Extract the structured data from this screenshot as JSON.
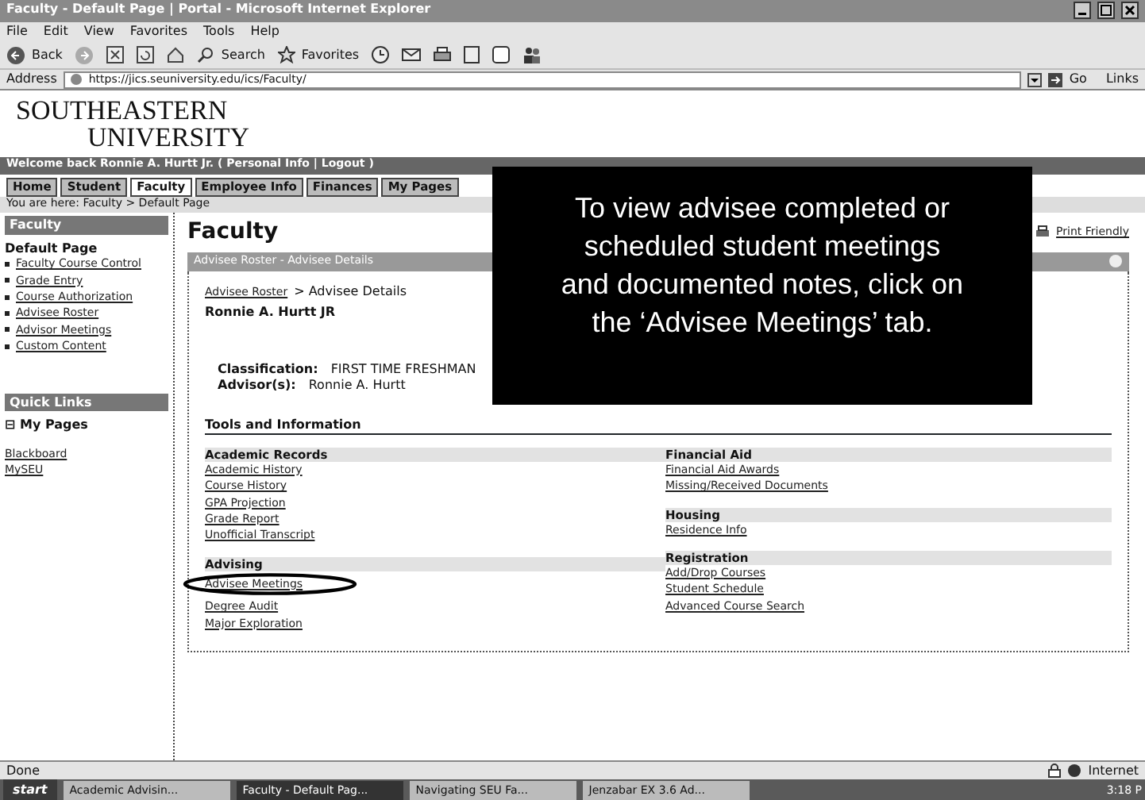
{
  "window": {
    "title": "Faculty - Default Page | Portal - Microsoft Internet Explorer"
  },
  "menu": [
    "File",
    "Edit",
    "View",
    "Favorites",
    "Tools",
    "Help"
  ],
  "toolbar": {
    "back": "Back",
    "search": "Search",
    "favorites": "Favorites"
  },
  "address": {
    "label": "Address",
    "value": "https://jics.seuniversity.edu/ics/Faculty/",
    "go": "Go",
    "links": "Links"
  },
  "logo": {
    "line_1": "SOUTHEASTERN",
    "line_2": "UNIVERSITY"
  },
  "welcome": "Welcome back Ronnie A. Hurtt Jr. ( Personal Info | Logout )",
  "tabs": [
    {
      "label": "Home",
      "selected": false
    },
    {
      "label": "Student",
      "selected": false
    },
    {
      "label": "Faculty",
      "selected": true
    },
    {
      "label": "Employee Info",
      "selected": false
    },
    {
      "label": "Finances",
      "selected": false
    },
    {
      "label": "My Pages",
      "selected": false
    }
  ],
  "breadcrumb": "You are here: Faculty > Default Page",
  "sidebar": {
    "header": "Faculty",
    "page": "Default Page",
    "items": [
      "Faculty Course Control",
      "Grade Entry",
      "Course Authorization",
      "Advisee Roster",
      "Advisor Meetings",
      "Custom Content"
    ],
    "quick_links_header": "Quick Links",
    "my_pages": "⊟ My Pages",
    "links": [
      "Blackboard",
      "MySEU"
    ]
  },
  "main": {
    "heading": "Faculty",
    "print": "Print Friendly",
    "portlet_title": "Advisee Roster - Advisee Details",
    "crumb_link": "Advisee Roster",
    "crumb_rest": "> Advisee Details",
    "student": "Ronnie A. Hurtt JR",
    "fields": [
      {
        "label": "Classification:",
        "value": "FIRST TIME FRESHMAN"
      },
      {
        "label": "Advisor(s):",
        "value": "Ronnie A. Hurtt"
      }
    ],
    "tools_heading": "Tools and Information",
    "left_groups": [
      {
        "title": "Academic Records",
        "links": [
          {
            "label": "Academic History",
            "circled": false
          },
          {
            "label": "Course History",
            "circled": false
          },
          {
            "label": "GPA Projection",
            "circled": false
          },
          {
            "label": "Grade Report",
            "circled": false
          },
          {
            "label": "Unofficial Transcript",
            "circled": false
          }
        ]
      },
      {
        "title": "Advising",
        "links": [
          {
            "label": "Advisee Meetings",
            "circled": true
          },
          {
            "label": "Degree Audit",
            "circled": false
          },
          {
            "label": "Major Exploration",
            "circled": false
          }
        ]
      }
    ],
    "right_groups": [
      {
        "title": "Financial Aid",
        "links": [
          {
            "label": "Financial Aid Awards",
            "circled": false
          },
          {
            "label": "Missing/Received Documents",
            "circled": false
          }
        ]
      },
      {
        "title": "Housing",
        "links": [
          {
            "label": "Residence Info",
            "circled": false
          }
        ]
      },
      {
        "title": "Registration",
        "links": [
          {
            "label": "Add/Drop Courses",
            "circled": false
          },
          {
            "label": "Student Schedule",
            "circled": false
          },
          {
            "label": "Advanced Course Search",
            "circled": false
          }
        ]
      }
    ]
  },
  "callout": [
    "To view advisee completed or",
    "scheduled student meetings",
    "and documented notes, click on",
    "the ‘Advisee Meetings’ tab."
  ],
  "status_bar": {
    "left": "Done",
    "zone": "Internet"
  },
  "taskbar": {
    "start": "start",
    "items": [
      {
        "label": "Academic Advisin...",
        "selected": false
      },
      {
        "label": "Faculty - Default Pag...",
        "selected": true
      },
      {
        "label": "Navigating SEU Fa...",
        "selected": false
      },
      {
        "label": "Jenzabar EX 3.6 Ad...",
        "selected": false
      }
    ],
    "clock": "3:18 P"
  }
}
